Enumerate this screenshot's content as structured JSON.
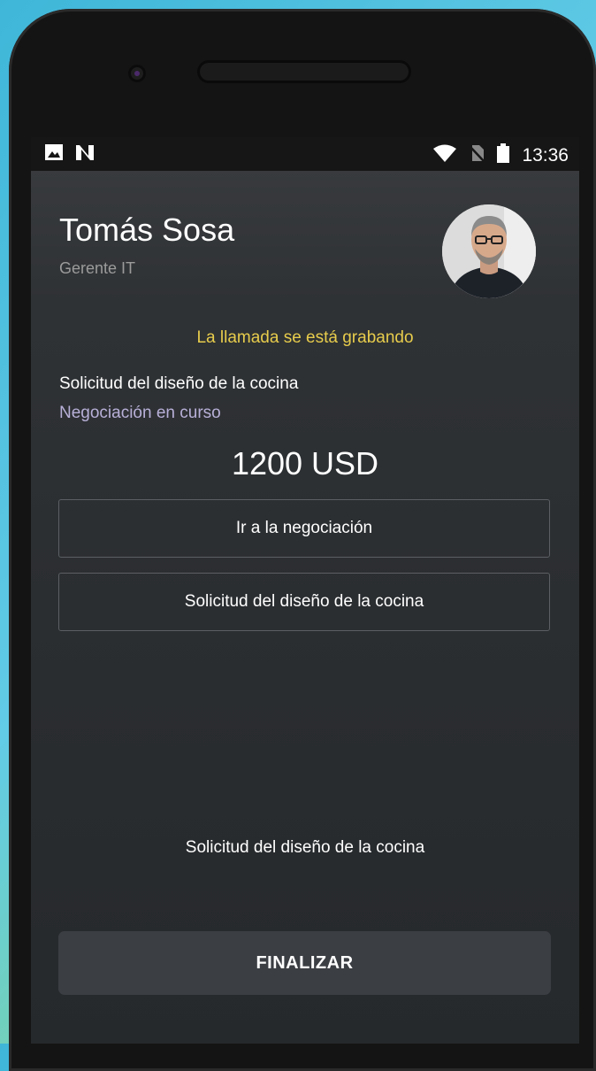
{
  "status_bar": {
    "left_icons": [
      "image-icon",
      "n-icon"
    ],
    "right_icons": [
      "wifi-icon",
      "no-sim-icon",
      "battery-icon"
    ],
    "time": "13:36"
  },
  "contact": {
    "name": "Tomás Sosa",
    "role": "Gerente IT"
  },
  "call": {
    "recording_notice": "La llamada se está grabando"
  },
  "deal": {
    "title": "Solicitud del diseño de la cocina",
    "status": "Negociación en curso",
    "amount": "1200 USD"
  },
  "actions": {
    "go_to_deal": "Ir a la negociación",
    "request": "Solicitud del diseño de la cocina"
  },
  "footer": {
    "caption": "Solicitud del diseño de la cocina",
    "finish_label": "FINALIZAR"
  },
  "colors": {
    "recording": "#e7cc4c",
    "status_text": "#b8b0d8"
  }
}
